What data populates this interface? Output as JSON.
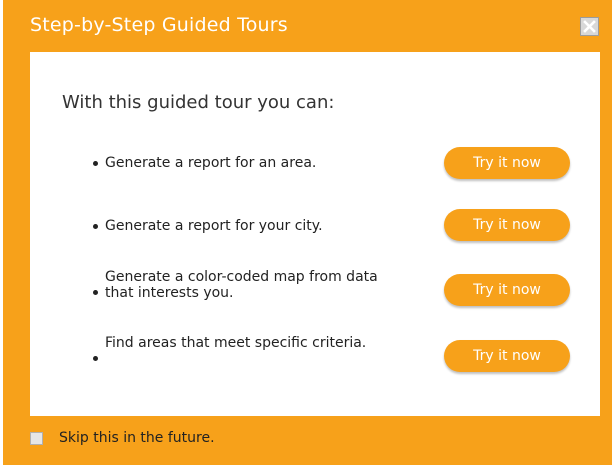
{
  "dialog": {
    "title": "Step-by-Step Guided Tours",
    "close_icon": "close-icon",
    "accent_color": "#f7a11a"
  },
  "content": {
    "intro": "With this guided tour you can:",
    "items": [
      {
        "text": "Generate a report for an area.",
        "button": "Try it now"
      },
      {
        "text": "Generate a report for your city.",
        "button": "Try it now"
      },
      {
        "text": "Generate a color-coded map from data that interests you.",
        "button": "Try it now"
      },
      {
        "text": "Find areas that meet specific criteria.",
        "button": "Try it now"
      }
    ]
  },
  "footer": {
    "skip_label": "Skip this in the future.",
    "skip_checked": false
  }
}
